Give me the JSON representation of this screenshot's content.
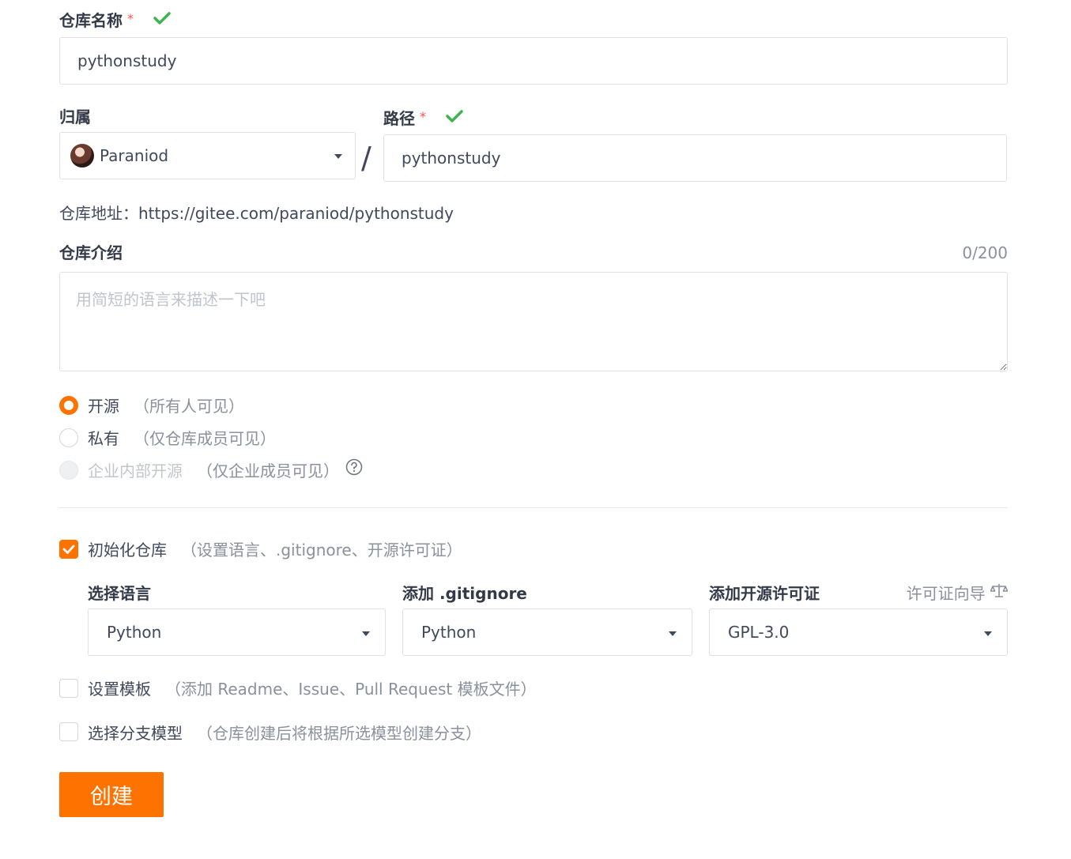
{
  "repo_name": {
    "label": "仓库名称",
    "required_mark": "*",
    "value": "pythonstudy"
  },
  "owner": {
    "label": "归属",
    "value": "Paraniod"
  },
  "separator": "/",
  "path": {
    "label": "路径",
    "required_mark": "*",
    "value": "pythonstudy"
  },
  "repo_address": {
    "prefix": "仓库地址：",
    "url": "https://gitee.com/paraniod/pythonstudy"
  },
  "description": {
    "label": "仓库介绍",
    "counter": "0/200",
    "placeholder": "用简短的语言来描述一下吧"
  },
  "visibility": {
    "options": [
      {
        "label": "开源",
        "hint": "（所有人可见）",
        "selected": true,
        "disabled": false
      },
      {
        "label": "私有",
        "hint": "（仅仓库成员可见）",
        "selected": false,
        "disabled": false
      },
      {
        "label": "企业内部开源",
        "hint": "（仅企业成员可见）",
        "selected": false,
        "disabled": true
      }
    ]
  },
  "init_repo": {
    "label": "初始化仓库",
    "hint": "（设置语言、.gitignore、开源许可证）",
    "checked": true
  },
  "language": {
    "label": "选择语言",
    "value": "Python"
  },
  "gitignore": {
    "label": "添加 .gitignore",
    "value": "Python"
  },
  "license": {
    "label": "添加开源许可证",
    "guide_link": "许可证向导",
    "value": "GPL-3.0"
  },
  "template": {
    "label": "设置模板",
    "hint": "（添加 Readme、Issue、Pull Request 模板文件）",
    "checked": false
  },
  "branch_model": {
    "label": "选择分支模型",
    "hint": "（仓库创建后将根据所选模型创建分支）",
    "checked": false
  },
  "submit": {
    "label": "创建"
  },
  "colors": {
    "accent": "#fe7300",
    "success": "#3fb34f",
    "required": "#ff4d4f"
  },
  "icons": {
    "valid": "check-icon",
    "dropdown": "caret-down-icon",
    "help": "question-circle-icon",
    "license_guide": "balance-scale-icon",
    "avatar": "avatar"
  }
}
